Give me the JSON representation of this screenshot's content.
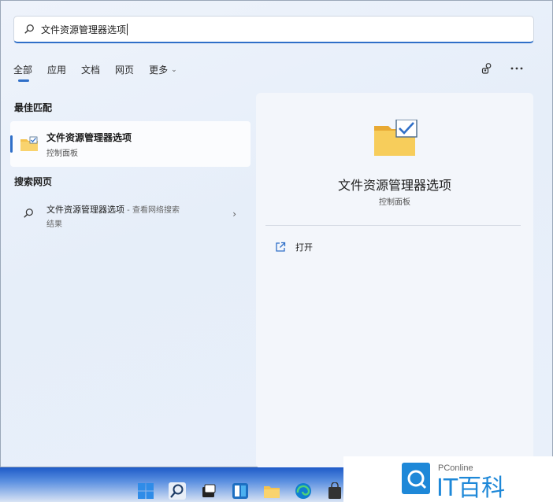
{
  "search": {
    "value": "文件资源管理器选项"
  },
  "tabs": [
    {
      "label": "全部"
    },
    {
      "label": "应用"
    },
    {
      "label": "文档"
    },
    {
      "label": "网页"
    },
    {
      "label": "更多"
    }
  ],
  "best_match": {
    "heading": "最佳匹配",
    "title": "文件资源管理器选项",
    "subtitle": "控制面板"
  },
  "web_search": {
    "heading": "搜索网页",
    "query": "文件资源管理器选项",
    "desc": " - 查看网络搜索",
    "desc2": "结果"
  },
  "detail": {
    "title": "文件资源管理器选项",
    "subtitle": "控制面板",
    "action_open": "打开"
  },
  "watermark": {
    "brand_small": "PConline",
    "brand_big": "IT百科"
  },
  "colors": {
    "accent": "#2f6fc8",
    "folder": "#f5c24c"
  }
}
